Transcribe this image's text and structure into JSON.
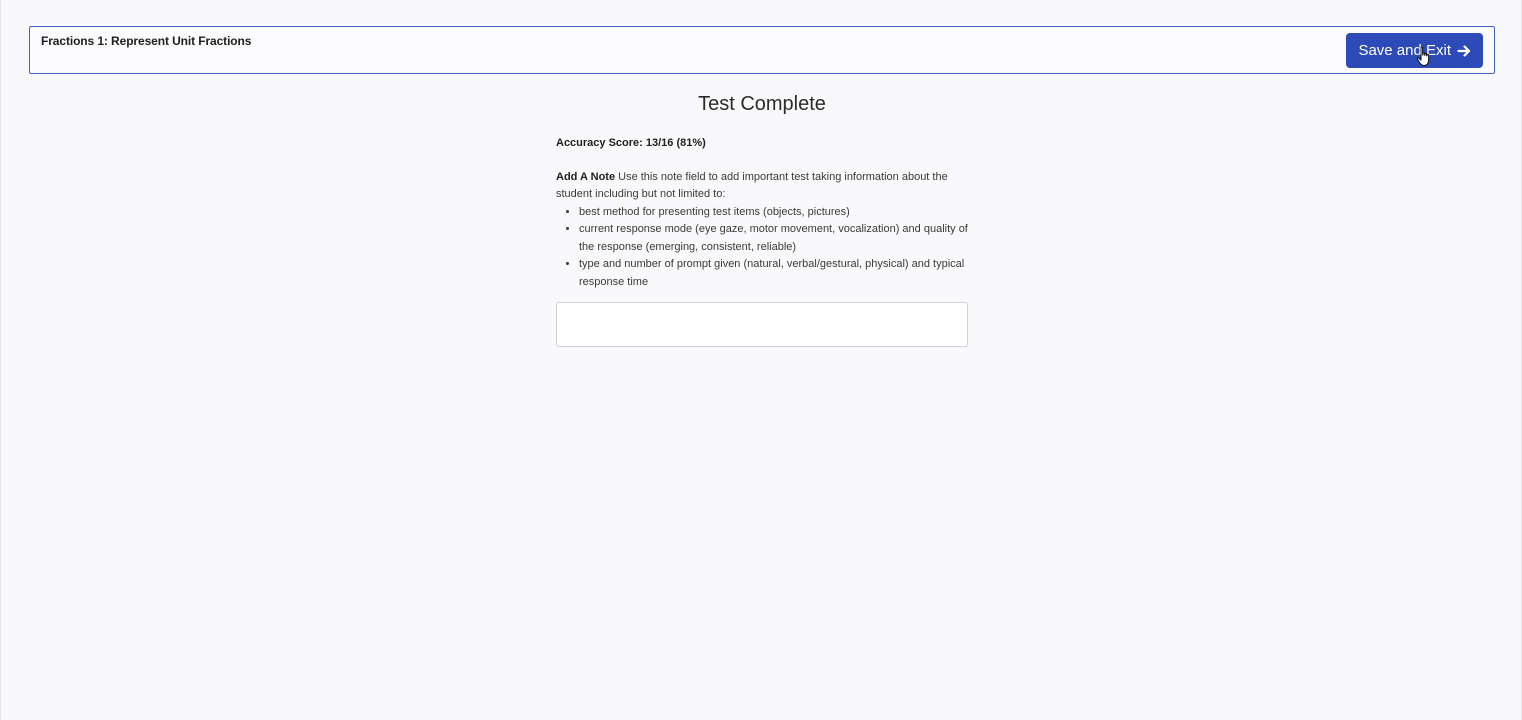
{
  "header": {
    "title": "Fractions 1: Represent Unit Fractions",
    "save_exit_label": "Save and Exit"
  },
  "main": {
    "title": "Test Complete",
    "accuracy_score": "Accuracy Score: 13/16 (81%)",
    "note": {
      "heading": "Add A Note",
      "intro": " Use this note field to add important test taking information about the student including but not limited to:",
      "items": [
        "best method for presenting test items (objects, pictures)",
        "current response mode (eye gaze, motor movement, vocalization) and quality of the response (emerging, consistent, reliable)",
        "type and number of prompt given (natural, verbal/gestural, physical) and typical response time"
      ],
      "field_value": ""
    }
  },
  "icons": {
    "save_exit": "arrow-right-icon",
    "cursor": "hand-pointer-icon"
  },
  "colors": {
    "accent": "#2c4bb8",
    "header_border": "#3f64c4",
    "background": "#f9f9fb"
  }
}
